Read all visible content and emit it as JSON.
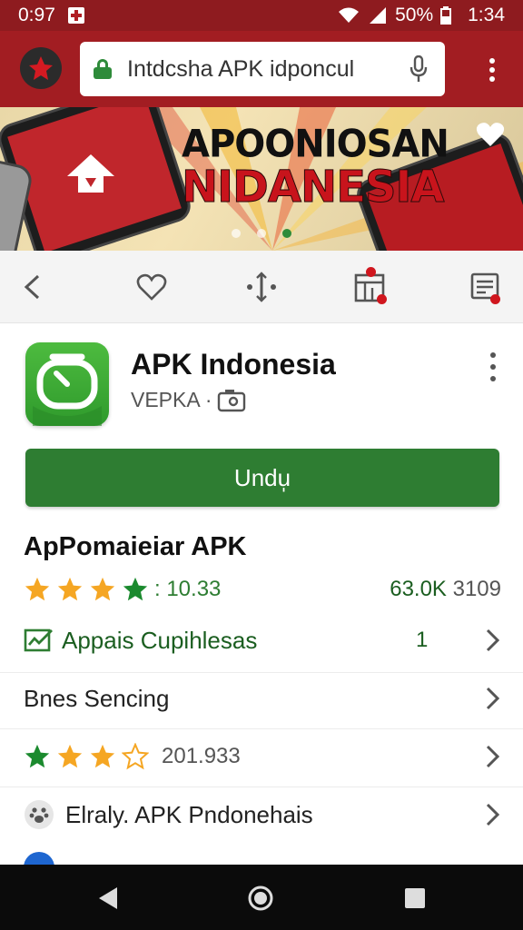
{
  "status_bar": {
    "left_time": "0:97",
    "battery": "50%",
    "clock": "1:34",
    "colors": {
      "bg": "#8e1b1f"
    }
  },
  "browser": {
    "url_text": "Intdcsha APK idponcul",
    "icons": [
      "app-logo-icon",
      "lock-icon",
      "mic-icon",
      "more-vert-icon"
    ]
  },
  "banner": {
    "line1": "APOONIOSAN",
    "line2": "NIDANESIA",
    "active_slide": 3,
    "slide_count": 3
  },
  "actions": {
    "icons": [
      "back-icon",
      "heart-icon",
      "share-move-icon",
      "apps-grid-icon",
      "notes-icon"
    ]
  },
  "app": {
    "name": "APK Indonesia",
    "developer": "VEPKA ·",
    "install_label": "Undu̩",
    "accent_color": "#2e7d32"
  },
  "details": {
    "title": "ApPomaieiar APK",
    "rating_stars": 4,
    "rating_value": ": 10.33",
    "downloads_primary": "63.0K",
    "downloads_secondary": "3109"
  },
  "list": [
    {
      "label": "Appais Cupihlesas",
      "value": "1",
      "icon": "chart-check-icon"
    },
    {
      "label": "Bnes Sencing",
      "value": ""
    },
    {
      "label": "201.933",
      "stars_filled": 3,
      "stars_total": 4
    },
    {
      "label": "Elraly. APK Pndonehais",
      "icon": "paw-icon"
    }
  ]
}
